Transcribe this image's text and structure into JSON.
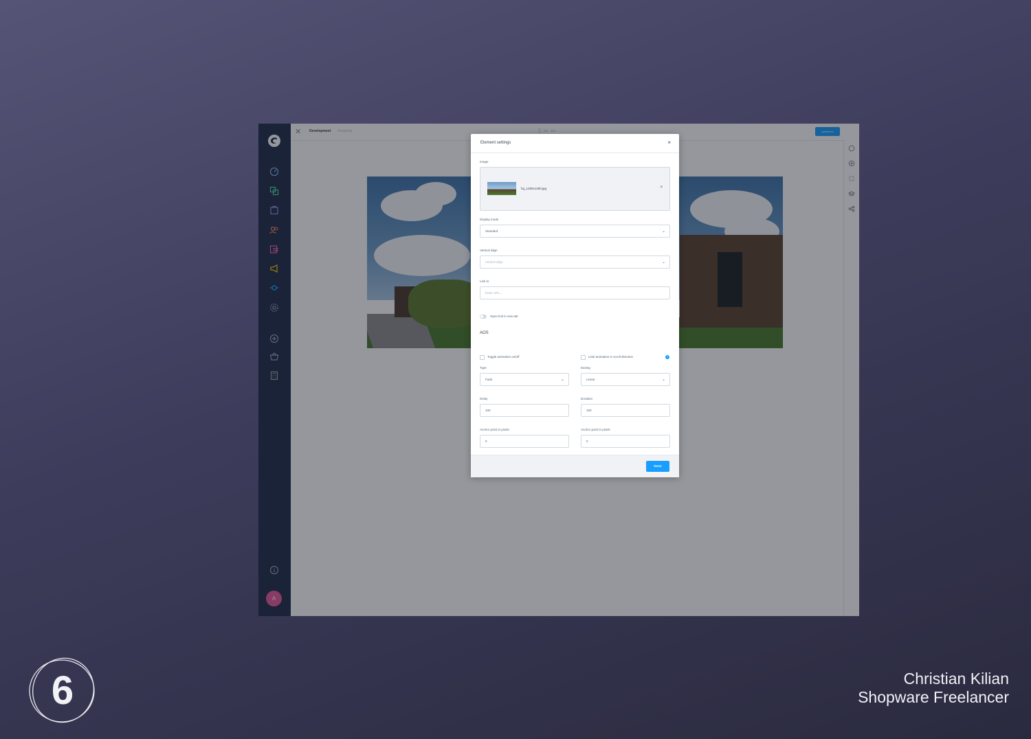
{
  "topbar": {
    "title": "Development",
    "subtitle": "Shopping",
    "save_label": "Speichern"
  },
  "sidebar": {
    "items": [
      {
        "name": "dashboard",
        "color": "#8fb3ff"
      },
      {
        "name": "catalogue",
        "color": "#57d9a3"
      },
      {
        "name": "orders",
        "color": "#a092f0"
      },
      {
        "name": "customers",
        "color": "#f88962"
      },
      {
        "name": "content",
        "color": "#ff68b4"
      },
      {
        "name": "marketing",
        "color": "#ffd700"
      },
      {
        "name": "extensions",
        "color": "#189eff"
      },
      {
        "name": "settings",
        "color": "#9aa8b5"
      },
      {
        "name": "add",
        "color": "#9aa8b5"
      },
      {
        "name": "store",
        "color": "#9aa8b5"
      },
      {
        "name": "calculator",
        "color": "#9aa8b5"
      },
      {
        "name": "info",
        "color": "#9aa8b5"
      }
    ],
    "avatar_initial": "A"
  },
  "modal": {
    "title": "Element settings",
    "image_label": "Image",
    "image_file": "hq_1280x1280.jpg",
    "display_mode_label": "Display mode",
    "display_mode_value": "Standard",
    "vertical_align_label": "Vertical align",
    "vertical_align_placeholder": "Vertical align",
    "link_label": "Link to",
    "link_placeholder": "Enter URL...",
    "new_tab_label": "Open link in new tab",
    "aos_heading": "AOS",
    "toggle_animation_label": "Toggle animation on/off",
    "limit_animation_label": "Limit animation in scroll direction",
    "type_label": "Type",
    "type_value": "Fade",
    "easing_label": "Easing",
    "easing_value": "Linear",
    "delay_label": "Delay",
    "delay_value": "100",
    "duration_label": "Duration",
    "duration_value": "100",
    "anchor_label_left": "Anchor point in pixels",
    "anchor_value_left": "0",
    "anchor_label_right": "Anchor point in pixels",
    "anchor_value_right": "0",
    "done_label": "Done"
  },
  "branding": {
    "name": "Christian Kilian",
    "role": "Shopware Freelancer",
    "logo_digit": "6"
  }
}
